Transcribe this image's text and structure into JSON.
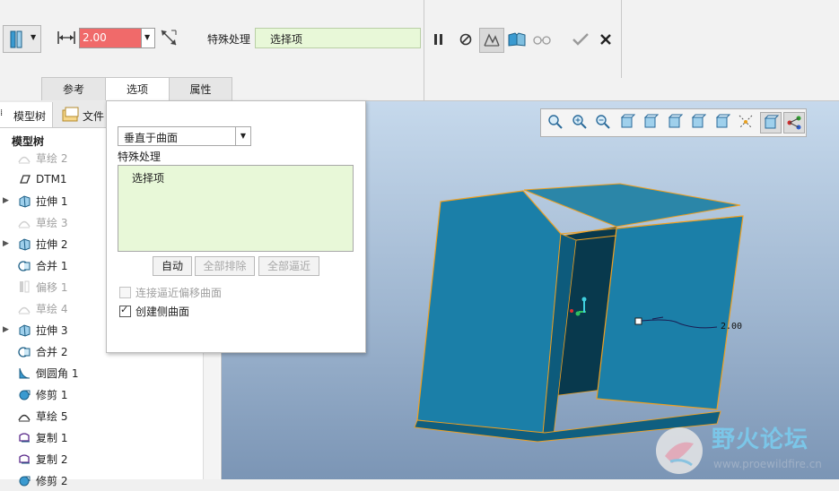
{
  "dashboard": {
    "thickness_value": "2.00",
    "special_label": "特殊处理",
    "special_field": "选择项"
  },
  "tabs": [
    {
      "label": "参考"
    },
    {
      "label": "选项"
    },
    {
      "label": "属性"
    }
  ],
  "tree": {
    "tab_model": "模型树",
    "tab_file": "文件",
    "header": "模型树",
    "items": [
      {
        "label": "草绘 2",
        "dim": true,
        "icon": "sketch-icon"
      },
      {
        "label": "DTM1",
        "dim": false,
        "icon": "datum-plane-icon"
      },
      {
        "label": "拉伸 1",
        "dim": false,
        "icon": "extrude-icon",
        "expandable": true
      },
      {
        "label": "草绘 3",
        "dim": true,
        "icon": "sketch-icon"
      },
      {
        "label": "拉伸 2",
        "dim": false,
        "icon": "extrude-icon",
        "expandable": true
      },
      {
        "label": "合并 1",
        "dim": false,
        "icon": "merge-icon"
      },
      {
        "label": "偏移 1",
        "dim": true,
        "icon": "offset-icon"
      },
      {
        "label": "草绘 4",
        "dim": true,
        "icon": "sketch-icon"
      },
      {
        "label": "拉伸 3",
        "dim": false,
        "icon": "extrude-icon",
        "expandable": true
      },
      {
        "label": "合并 2",
        "dim": false,
        "icon": "merge-icon"
      },
      {
        "label": "倒圆角 1",
        "dim": false,
        "icon": "round-icon"
      },
      {
        "label": "修剪 1",
        "dim": false,
        "icon": "trim-icon"
      },
      {
        "label": "草绘 5",
        "dim": false,
        "icon": "sketch-icon"
      },
      {
        "label": "复制 1",
        "dim": false,
        "icon": "copy-icon"
      },
      {
        "label": "复制 2",
        "dim": false,
        "icon": "copy-icon"
      },
      {
        "label": "修剪 2",
        "dim": false,
        "icon": "trim-icon"
      }
    ]
  },
  "options_panel": {
    "method_select": "垂直于曲面",
    "special_label": "特殊处理",
    "collector_item": "选择项",
    "btn_auto": "自动",
    "btn_exclude_all": "全部排除",
    "btn_approx_all": "全部逼近",
    "chk_connect_label": "连接逼近偏移曲面",
    "chk_connect_checked": false,
    "chk_side_label": "创建侧曲面",
    "chk_side_checked": true
  },
  "viewport": {
    "dimension_label": "2.00"
  },
  "watermark": {
    "title": "野火论坛",
    "url": "www.proewildfire.cn"
  },
  "colors": {
    "accent_red": "#f06a6a",
    "collector_green": "#e8f8d8",
    "model_blue": "#1b7fa8",
    "edge_orange": "#f0a020"
  }
}
